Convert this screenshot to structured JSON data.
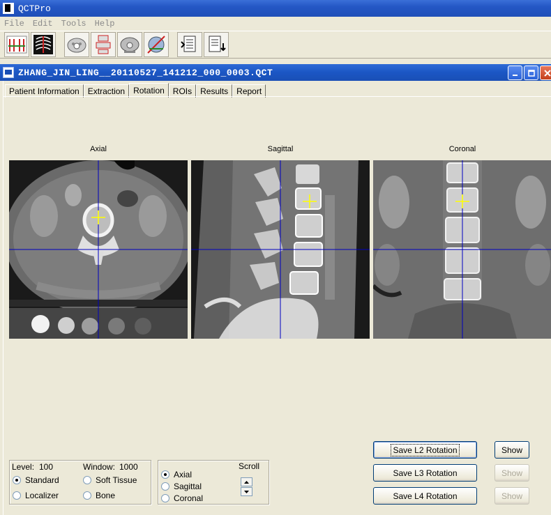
{
  "app": {
    "title": "QCTPro"
  },
  "menu": [
    "File",
    "Edit",
    "Tools",
    "Help"
  ],
  "toolbar": {
    "icons": [
      "spine-analysis-icon",
      "ribs-scan-icon",
      "axial-slice-icon",
      "roi-placement-icon",
      "axial-body-icon",
      "calibration-icon",
      "report-export-icon",
      "report-print-icon"
    ]
  },
  "document": {
    "title": "ZHANG_JIN_LING__20110527_141212_000_0003.QCT"
  },
  "tabs": [
    "Patient Information",
    "Extraction",
    "Rotation",
    "ROIs",
    "Results",
    "Report"
  ],
  "active_tab": "Rotation",
  "views": {
    "axial": "Axial",
    "sagittal": "Sagittal",
    "coronal": "Coronal"
  },
  "display": {
    "level_label": "Level:",
    "level_value": "100",
    "window_label": "Window:",
    "window_value": "1000",
    "presets": [
      {
        "label": "Standard",
        "selected": true
      },
      {
        "label": "Soft Tissue",
        "selected": false
      },
      {
        "label": "Localizer",
        "selected": false
      },
      {
        "label": "Bone",
        "selected": false
      }
    ]
  },
  "scroll": {
    "title": "Scroll",
    "options": [
      {
        "label": "Axial",
        "selected": true
      },
      {
        "label": "Sagittal",
        "selected": false
      },
      {
        "label": "Coronal",
        "selected": false
      }
    ]
  },
  "actions": [
    {
      "label": "Save L2 Rotation",
      "show": "Show",
      "show_enabled": true
    },
    {
      "label": "Save L3 Rotation",
      "show": "Show",
      "show_enabled": false
    },
    {
      "label": "Save L4 Rotation",
      "show": "Show",
      "show_enabled": false
    }
  ],
  "colors": {
    "crosshair_center": "#ffff00",
    "crosshair_lines": "#0000c0",
    "titlebar": "#1f4fb8"
  }
}
